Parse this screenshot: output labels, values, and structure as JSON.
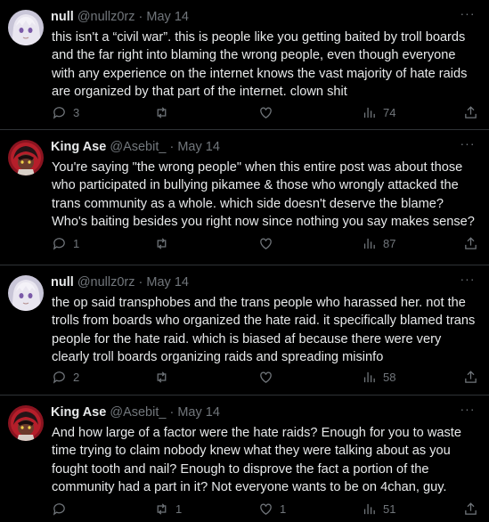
{
  "tweets": [
    {
      "name": "null",
      "handle": "@nullz0rz",
      "sep": "·",
      "date": "May 14",
      "text": "this isn't a “civil war”. this is people like you getting baited by troll boards and the far right into blaming the wrong people, even though everyone with any experience on the internet knows the vast majority of hate raids are organized by that part of the internet. clown shit",
      "replies": "3",
      "retweets": "",
      "likes": "",
      "views": "74"
    },
    {
      "name": "King Ase",
      "handle": "@Asebit_",
      "sep": "·",
      "date": "May 14",
      "text": "You're saying \"the wrong people\" when this entire post was about those who participated in bullying pikamee & those who wrongly attacked the trans community as a whole. which side doesn't deserve the blame? Who's baiting besides you right now since nothing you say makes sense?",
      "replies": "1",
      "retweets": "",
      "likes": "",
      "views": "87"
    },
    {
      "name": "null",
      "handle": "@nullz0rz",
      "sep": "·",
      "date": "May 14",
      "text": "the op said transphobes and the trans people who harassed her. not the trolls from boards who organized the hate raid. it specifically blamed trans people for the hate raid. which is biased af because there were very clearly troll boards organizing raids and spreading misinfo",
      "replies": "2",
      "retweets": "",
      "likes": "",
      "views": "58"
    },
    {
      "name": "King Ase",
      "handle": "@Asebit_",
      "sep": "·",
      "date": "May 14",
      "text": "And how large of a factor were the hate raids? Enough for you to waste time trying to claim nobody knew what they were talking about as you fought tooth and nail? Enough to disprove the fact a portion of the community had a part in it? Not everyone wants to be on 4chan, guy.",
      "replies": "",
      "retweets": "1",
      "likes": "1",
      "views": "51"
    }
  ],
  "more_glyph": "···"
}
